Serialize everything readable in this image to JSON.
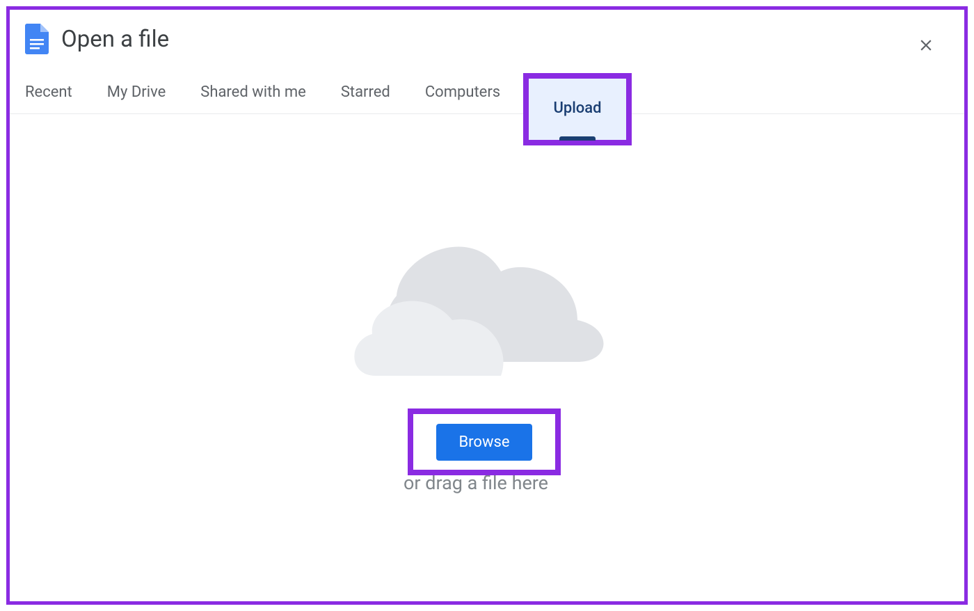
{
  "header": {
    "title": "Open a file"
  },
  "tabs": {
    "items": [
      {
        "label": "Recent"
      },
      {
        "label": "My Drive"
      },
      {
        "label": "Shared with me"
      },
      {
        "label": "Starred"
      },
      {
        "label": "Computers"
      },
      {
        "label": "Upload",
        "active": true
      }
    ]
  },
  "upload": {
    "browse_label": "Browse",
    "drag_text": "or drag a file here"
  }
}
